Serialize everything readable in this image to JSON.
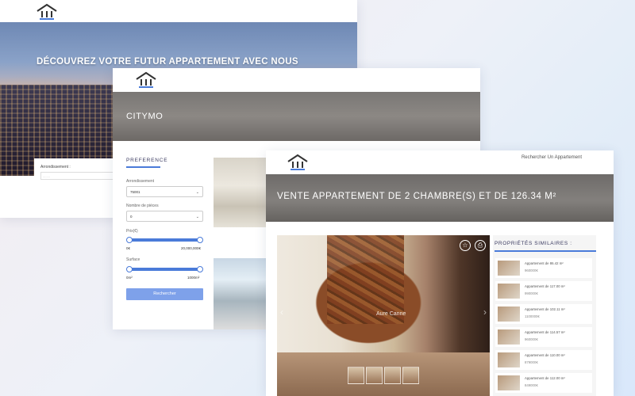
{
  "window_home": {
    "hero_title": "DÉCOUVREZ VOTRE FUTUR APPARTEMENT AVEC NOUS",
    "search_label": "Arrondissement :",
    "search_placeholder": "........"
  },
  "window_search": {
    "banner_title": "CITYMO",
    "preference_title": "PREFERENCE",
    "arrondissement_label": "Arrondissement",
    "arrondissement_value": "75001",
    "pieces_label": "Nombre de pièces",
    "pieces_value": "0",
    "prix_label": "Prix(€)",
    "prix_min": "0€",
    "prix_max": "20,000,000€",
    "prix_range": [
      0,
      1
    ],
    "surface_label": "Surface",
    "surface_min": "0m²",
    "surface_max": "1000m²",
    "surface_range": [
      0,
      1
    ],
    "search_button": "Rechercher"
  },
  "window_detail": {
    "nav_link": "Rechercher Un Appartement",
    "banner_title": "VENTE APPARTEMENT DE 2 CHAMBRE(S) ET DE 126.34 M²",
    "photo_caption": "Aure Canne",
    "similar_title": "PROPRIÉTÉS SIMILAIRES :",
    "similar": [
      {
        "title": "Appartement de 86.42 m²",
        "price": "960000€"
      },
      {
        "title": "Appartement de 117.00 m²",
        "price": "990000€"
      },
      {
        "title": "Appartement de 102.11 m²",
        "price": "1100000€"
      },
      {
        "title": "Appartement de 114.57 m²",
        "price": "960000€"
      },
      {
        "title": "Appartement de 110.00 m²",
        "price": "879000€"
      },
      {
        "title": "Appartement de 112.00 m²",
        "price": "849000€"
      }
    ]
  },
  "icons": {
    "logo": "citymo-logo",
    "favorite": "star-icon",
    "print": "print-icon"
  },
  "colors": {
    "accent": "#4a7bd9",
    "button": "#7ea1ea"
  }
}
